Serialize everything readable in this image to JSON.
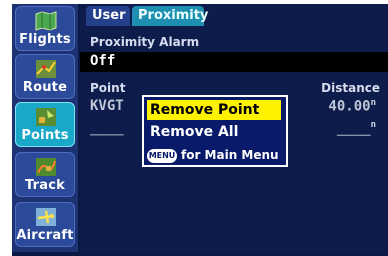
{
  "sidebar": {
    "items": [
      {
        "label": "Flights",
        "icon": "flights-icon"
      },
      {
        "label": "Route",
        "icon": "route-icon"
      },
      {
        "label": "Points",
        "icon": "points-icon",
        "active": true
      },
      {
        "label": "Track",
        "icon": "track-icon"
      },
      {
        "label": "Aircraft",
        "icon": "aircraft-icon"
      }
    ]
  },
  "tabs": [
    {
      "label": "User"
    },
    {
      "label": "Proximity",
      "active": true
    }
  ],
  "alarm": {
    "label": "Proximity Alarm",
    "value": "Off"
  },
  "table": {
    "col_point": "Point",
    "col_distance": "Distance",
    "rows": [
      {
        "point": "KVGT",
        "distance": "40.00",
        "unit": "n"
      },
      {
        "point": "____",
        "distance": "____",
        "unit": "n"
      }
    ]
  },
  "popup": {
    "items": [
      {
        "label": "Remove Point",
        "selected": true
      },
      {
        "label": "Remove All"
      }
    ],
    "key_label": "MENU",
    "hint": "for Main Menu"
  },
  "colors": {
    "selection": "#fff200",
    "active_tab": "#19a8c8",
    "background": "#0b1a44"
  }
}
